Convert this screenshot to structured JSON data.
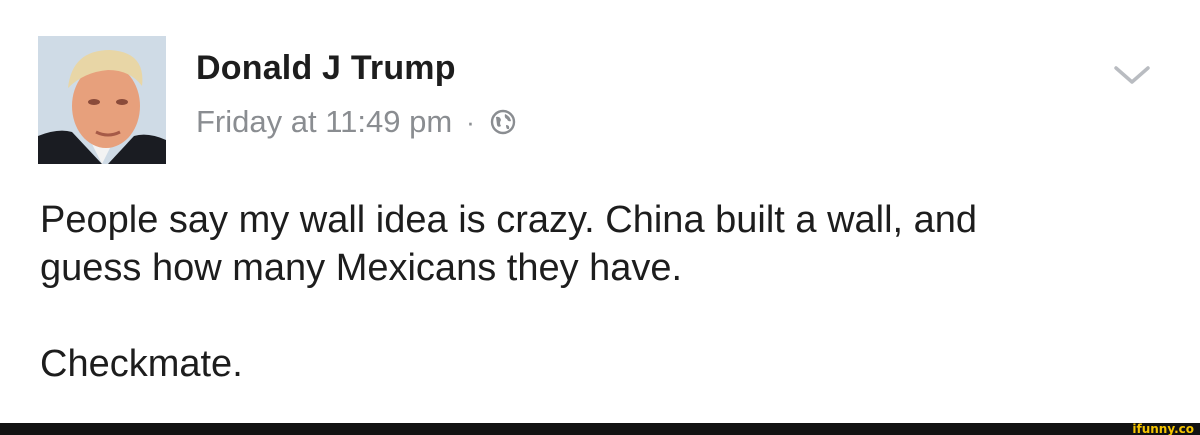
{
  "post": {
    "author": "Donald J Trump",
    "timestamp": "Friday at 11:49 pm",
    "separator": "·",
    "privacy_icon": "globe-icon",
    "menu_icon": "chevron-down-icon",
    "body_lines": [
      "People say my wall idea is crazy. China built a wall, and",
      "guess how many Mexicans they have."
    ],
    "closing_line": "Checkmate."
  },
  "watermark": {
    "text": "ifunny.co",
    "color": "#f5c400"
  },
  "colors": {
    "text": "#1d1d1d",
    "meta": "#8a8d91",
    "bar": "#121212"
  }
}
